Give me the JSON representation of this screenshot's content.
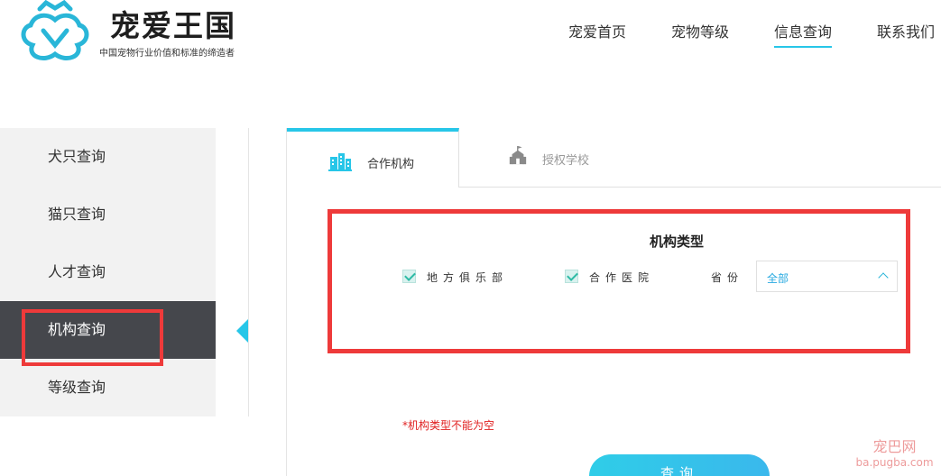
{
  "brand": {
    "title": "宠爱王国",
    "tagline": "中国宠物行业价值和标准的缔造者"
  },
  "topnav": {
    "items": [
      {
        "label": "宠爱首页"
      },
      {
        "label": "宠物等级"
      },
      {
        "label": "信息查询",
        "active": true
      },
      {
        "label": "联系我们"
      }
    ]
  },
  "sidebar": {
    "items": [
      {
        "label": "犬只查询"
      },
      {
        "label": "猫只查询"
      },
      {
        "label": "人才查询"
      },
      {
        "label": "机构查询",
        "active": true
      },
      {
        "label": "等级查询"
      }
    ]
  },
  "tabs": [
    {
      "label": "合作机构",
      "icon": "buildings-icon",
      "active": true
    },
    {
      "label": "授权学校",
      "icon": "school-icon",
      "active": false
    }
  ],
  "filter": {
    "title": "机构类型",
    "options": [
      {
        "label": "地方俱乐部",
        "checked": true
      },
      {
        "label": "合作医院",
        "checked": true
      }
    ],
    "province_label": "省份",
    "province_value": "全部"
  },
  "error": "*机构类型不能为空",
  "query_button": "查询",
  "watermark": {
    "line1": "宠巴网",
    "line2": "ba.pugba.com"
  },
  "colors": {
    "accent": "#27c6e8",
    "sidebar_active": "#45474c",
    "highlight_box": "#ee3a3a",
    "error": "#e02020"
  }
}
